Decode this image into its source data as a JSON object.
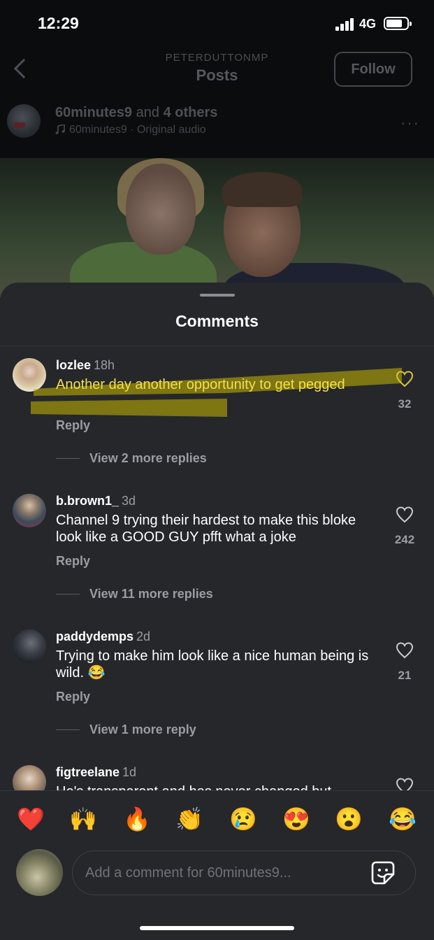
{
  "status_bar": {
    "time": "12:29",
    "network": "4G"
  },
  "header": {
    "account": "PETERDUTTONMP",
    "title": "Posts",
    "follow_label": "Follow"
  },
  "post": {
    "author": "60minutes9",
    "joiner": "and",
    "others": "4 others",
    "audio": "60minutes9 · Original audio",
    "more": "···"
  },
  "sheet": {
    "title": "Comments"
  },
  "comments": [
    {
      "user": "lozlee",
      "ago": "18h",
      "text": "Another day another opportunity to get pegged",
      "reply": "Reply",
      "view_more": "View 2 more replies",
      "likes": "32",
      "highlighted": true
    },
    {
      "user": "b.brown1_",
      "ago": "3d",
      "text": "Channel 9 trying their hardest to make this bloke look like a GOOD GUY pfft what a joke",
      "reply": "Reply",
      "view_more": "View 11 more replies",
      "likes": "242"
    },
    {
      "user": "paddydemps",
      "ago": "2d",
      "text": "Trying to make him look like a nice human being is wild. 😂",
      "reply": "Reply",
      "view_more": "View 1 more reply",
      "likes": "21"
    },
    {
      "user": "figtreelane",
      "ago": "1d",
      "text": "He's transparent and has never changed but",
      "reply": "",
      "view_more": "",
      "likes": ""
    }
  ],
  "reactions": [
    "❤️",
    "🙌",
    "🔥",
    "👏",
    "😢",
    "😍",
    "😮",
    "😂"
  ],
  "composer": {
    "placeholder": "Add a comment for 60minutes9..."
  },
  "colors": {
    "sheet_bg": "#25272b",
    "highlight": "#c9b600",
    "muted": "#9a9da2"
  }
}
